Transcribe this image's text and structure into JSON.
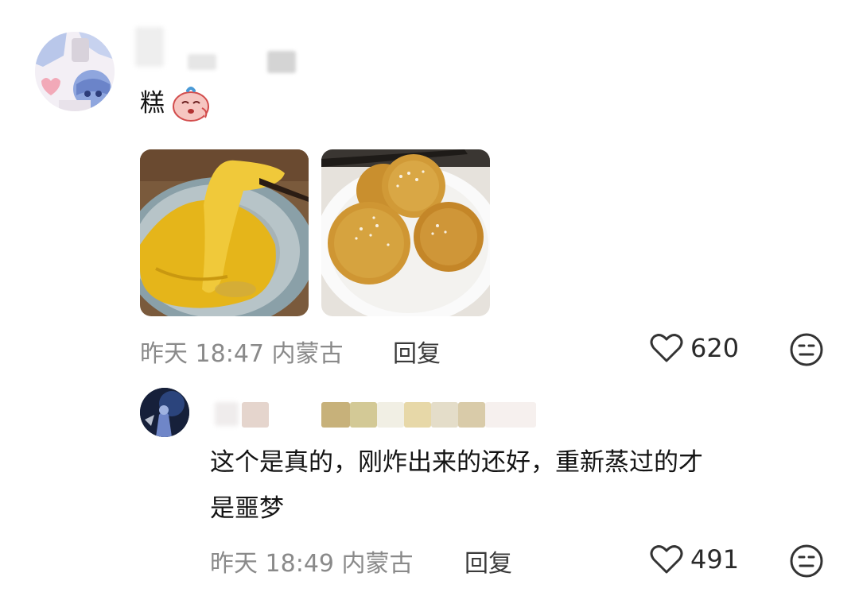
{
  "comments": [
    {
      "text": "糕",
      "time": "昨天 18:47",
      "location": "内蒙古",
      "reply_label": "回复",
      "likes": "620",
      "images": [
        "durian-cake-photo",
        "fried-rice-cakes-photo"
      ]
    },
    {
      "text_line1": "这个是真的，刚炸出来的还好，重新蒸过的才",
      "text_line2": "是噩梦",
      "time": "昨天 18:49",
      "location": "内蒙古",
      "reply_label": "回复",
      "likes": "491"
    }
  ],
  "icons": {
    "heart": "heart-outline-icon",
    "emoji": "neutral-face-icon",
    "sticker": "crying-bean-sticker"
  },
  "colors": {
    "meta": "#8a8a8a",
    "text": "#141414",
    "durian": "#e8b81a",
    "fried": "#c98f2e"
  }
}
